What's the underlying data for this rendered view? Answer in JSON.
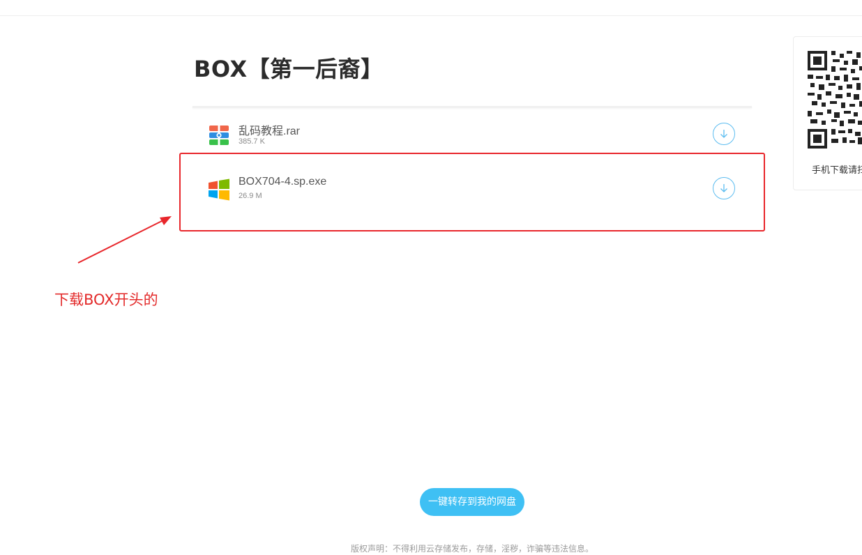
{
  "folder": {
    "title": "BOX【第一后裔】"
  },
  "files": [
    {
      "name": "乱码教程.rar",
      "size": "385.7 K",
      "icon": "archive-rar-icon"
    },
    {
      "name": "BOX704-4.sp.exe",
      "size": "26.9 M",
      "icon": "windows-exe-icon"
    }
  ],
  "annotation": {
    "text": "下载BOX开头的",
    "color": "#e32a2a"
  },
  "qr": {
    "caption": "手机下载请扫码"
  },
  "actions": {
    "save_label": "一键转存到我的网盘"
  },
  "footer": {
    "copyright": "版权声明：不得利用云存储发布，存储，淫秽，诈骗等违法信息。"
  },
  "colors": {
    "accent": "#3fc0f4",
    "download_ring": "#5bbcf0",
    "highlight": "#e8262b"
  }
}
